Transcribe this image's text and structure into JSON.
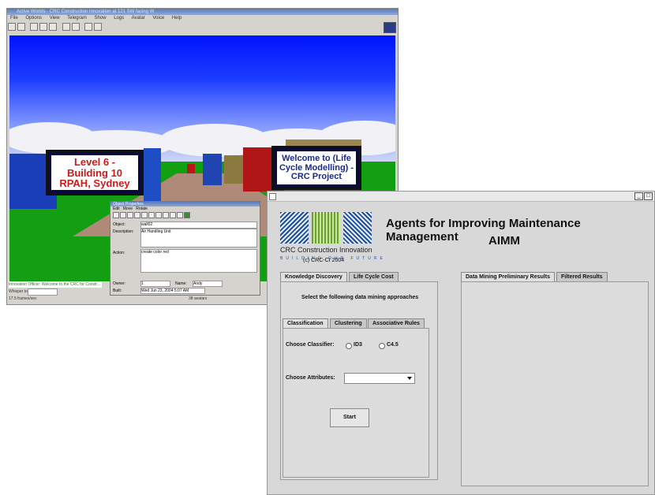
{
  "world_window": {
    "title": "Active Worlds - CRC Construction Innovation at 121 SW facing W",
    "menu": [
      "File",
      "Options",
      "View",
      "Telegram",
      "Show",
      "Logs",
      "Avatar",
      "Voice",
      "Help"
    ],
    "sign_left": {
      "line1": "Level 6 -",
      "line2": "Building 10",
      "line3": "RPAH, Sydney"
    },
    "sign_right": {
      "line1": "Welcome to (Life",
      "line2": "Cycle Modelling) -",
      "line3": "CRC Project"
    },
    "object_properties": {
      "title": "Object Properties",
      "menu": [
        "Edit",
        "Move",
        "Rotate"
      ],
      "object_label": "Object:",
      "object_value": "wall02",
      "description_label": "Description:",
      "description_value": "Air Handling Unit",
      "action_label": "Action:",
      "action_value": "create color red",
      "owner_label": "Owner:",
      "owner_value": "1",
      "name_label": "Name:",
      "name_value": "Andy",
      "built_label": "Built:",
      "built_value": "Wed Jun 23, 2004 5:07 AM"
    },
    "chat_line": "Innovation Officer:  Welcome to the CRC for Constr...",
    "whisper_label": "Whisper to:",
    "status_fps": "17.5 frames/sec",
    "status_objects": "38 avatars"
  },
  "aimm_window": {
    "minimize": "_",
    "maximize": "□",
    "logo_title": "CRC Construction Innovation",
    "logo_sub": "BUILDING OUR FUTURE",
    "copyright": "(c) CRC-CI 2004",
    "heading_line1": "Agents for Improving Maintenance Management",
    "heading_line2": "AIMM",
    "left_tabs": [
      "Knowledge Discovery",
      "Life Cycle Cost"
    ],
    "instructions": "Select the following data mining approaches",
    "inner_tabs": [
      "Classification",
      "Clustering",
      "Associative Rules"
    ],
    "choose_classifier": "Choose Classifier:",
    "options": [
      "ID3",
      "C4.5"
    ],
    "choose_attributes": "Choose Attributes:",
    "attribute_value": "",
    "start_label": "Start",
    "right_tabs": [
      "Data Mining Preliminary Results",
      "Filtered Results"
    ]
  },
  "colors": {
    "sky_top": "#0013ff",
    "grass": "#12a012",
    "sign_text_red": "#cc1a1a",
    "sign_text_blue": "#1a2a8a",
    "crc_blue": "#1e4f9a",
    "crc_green": "#7dbb3c"
  }
}
